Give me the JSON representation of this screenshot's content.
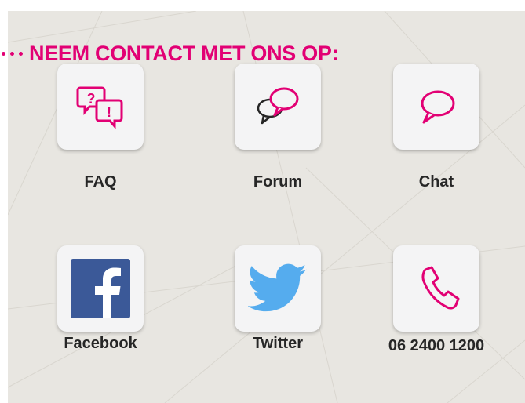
{
  "heading": "NEEM CONTACT MET ONS OP:",
  "colors": {
    "accent": "#e20074",
    "facebook": "#3b5998",
    "twitter": "#55acee",
    "panel": "#e8e6e1"
  },
  "contacts": [
    {
      "label": "FAQ",
      "icon": "faq-icon"
    },
    {
      "label": "Forum",
      "icon": "forum-icon"
    },
    {
      "label": "Chat",
      "icon": "chat-icon"
    },
    {
      "label": "Facebook",
      "icon": "facebook-icon"
    },
    {
      "label": "Twitter",
      "icon": "twitter-icon"
    },
    {
      "label": "06 2400 1200",
      "icon": "phone-icon"
    }
  ]
}
